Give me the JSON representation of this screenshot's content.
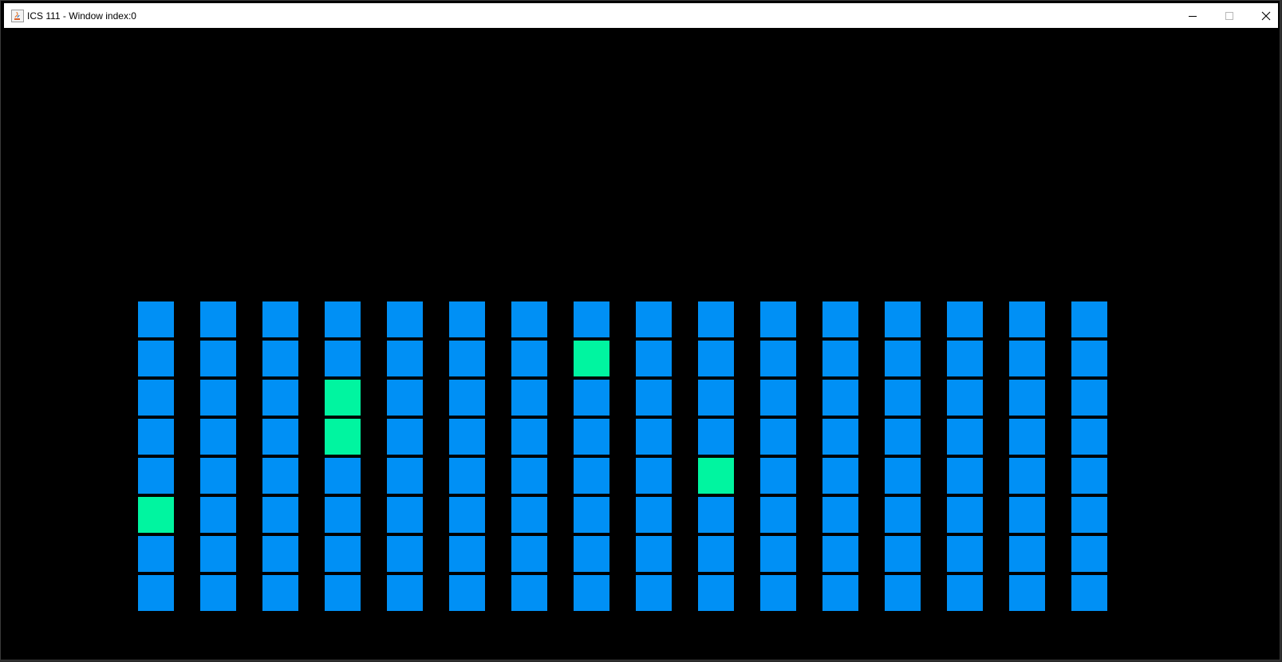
{
  "window": {
    "title": "ICS 111 - Window index:0",
    "controls": {
      "minimize": "minimize-icon",
      "maximize": "maximize-icon",
      "close": "close-icon"
    }
  },
  "colors": {
    "background": "#000000",
    "tile_default": "#0090f5",
    "tile_active": "#00f5a0"
  },
  "grid": {
    "rows": 8,
    "columns": 16,
    "active_cells": [
      {
        "row": 2,
        "col": 8
      },
      {
        "row": 3,
        "col": 4
      },
      {
        "row": 4,
        "col": 4
      },
      {
        "row": 5,
        "col": 10
      },
      {
        "row": 6,
        "col": 1
      }
    ]
  }
}
